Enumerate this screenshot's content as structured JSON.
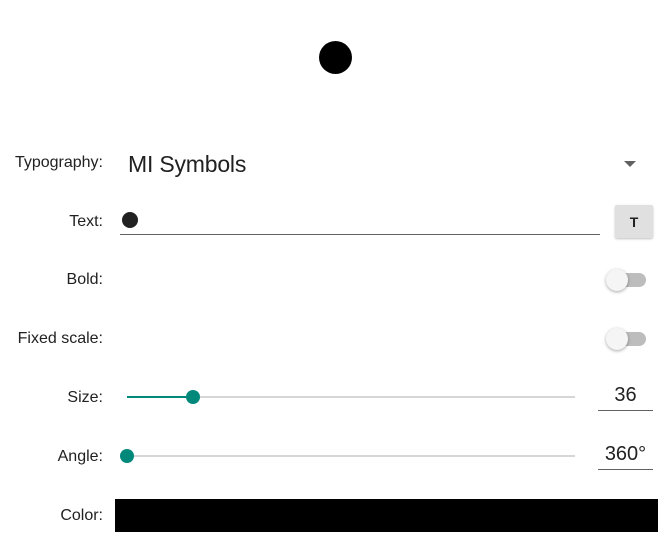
{
  "preview": {
    "glyph_color": "#000000"
  },
  "typography": {
    "label": "Typography:",
    "value": "MI Symbols"
  },
  "text": {
    "label": "Text:",
    "button_label": "T"
  },
  "bold": {
    "label": "Bold:",
    "on": false
  },
  "fixed_scale": {
    "label": "Fixed scale:",
    "on": false
  },
  "size": {
    "label": "Size:",
    "value": "36",
    "slider_fraction": 0.147
  },
  "angle": {
    "label": "Angle:",
    "value": "360°",
    "slider_fraction": 0.0
  },
  "color": {
    "label": "Color:",
    "value": "#000000"
  },
  "accent_color": "#00897b"
}
